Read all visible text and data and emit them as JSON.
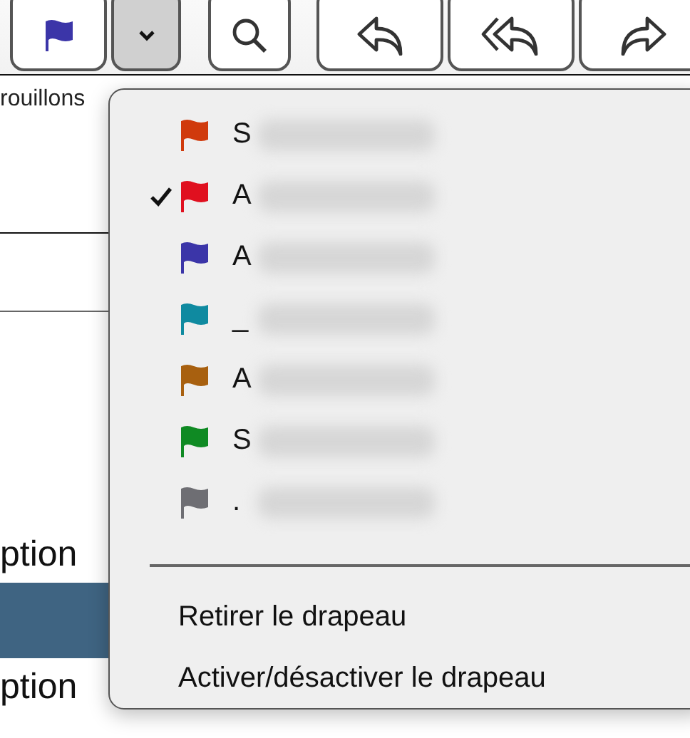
{
  "mailbox_list": {
    "folder_label": "rouillons",
    "rows": [
      {
        "text": "ption",
        "selected": false
      },
      {
        "selected": true
      },
      {
        "text": "ption",
        "selected": false
      }
    ]
  },
  "flag_menu": {
    "items": [
      {
        "label": "S",
        "color": "#d03a0c",
        "checked": false
      },
      {
        "label": "A",
        "color": "#e0101f",
        "checked": true
      },
      {
        "label": "A",
        "color": "#3b35a8",
        "checked": false
      },
      {
        "label": "_",
        "color": "#0f8aa0",
        "checked": false
      },
      {
        "label": "A",
        "color": "#a8600f",
        "checked": false
      },
      {
        "label": "S",
        "color": "#0f8a23",
        "checked": false
      },
      {
        "label": ".",
        "color": "#6e6e73",
        "checked": false
      }
    ],
    "actions": [
      "Retirer le drapeau",
      "Activer/désactiver le drapeau"
    ]
  }
}
